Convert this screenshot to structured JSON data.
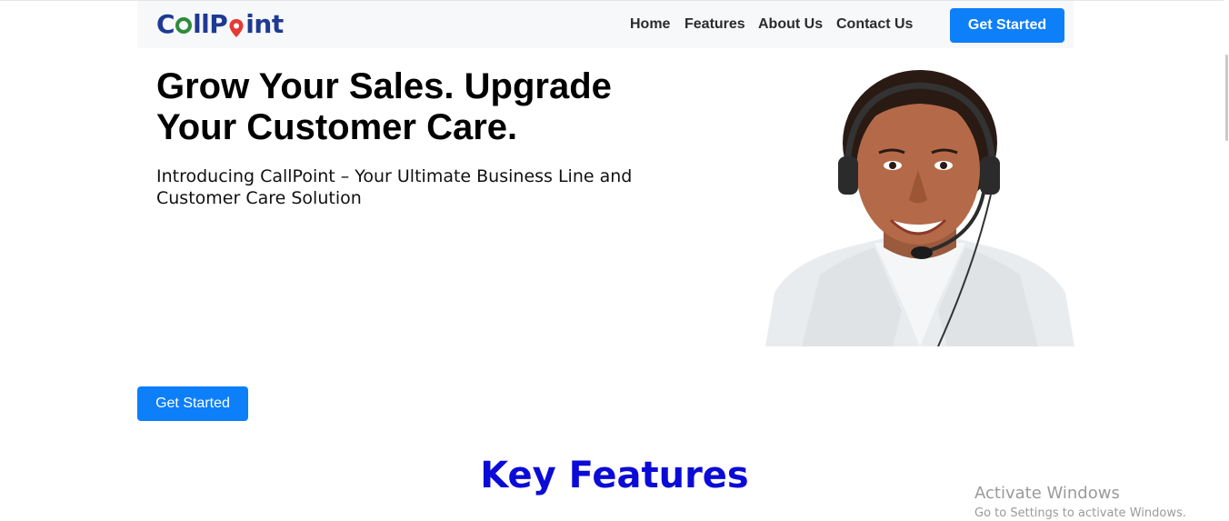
{
  "brand": {
    "logo_text_c": "C",
    "logo_text_ll": "ll",
    "logo_text_int": "int",
    "logo_colors": {
      "primary": "#1f3a93",
      "green": "#2e8b3d",
      "red": "#e53935"
    }
  },
  "nav": {
    "items": [
      {
        "label": "Home"
      },
      {
        "label": "Features"
      },
      {
        "label": "About Us"
      },
      {
        "label": "Contact Us"
      }
    ],
    "cta_label": "Get Started"
  },
  "hero": {
    "title": "Grow Your Sales. Upgrade Your Customer Care.",
    "subtitle": "Introducing CallPoint – Your Ultimate Business Line and Customer Care Solution",
    "cta_label": "Get Started",
    "image_alt": "customer service agent with headset"
  },
  "features": {
    "title": "Key Features"
  },
  "watermark": {
    "title": "Activate Windows",
    "subtitle": "Go to Settings to activate Windows."
  },
  "colors": {
    "accent": "#0d7ff9",
    "section_title": "#0b0bd8",
    "navbar_bg": "#f7f8f9"
  }
}
